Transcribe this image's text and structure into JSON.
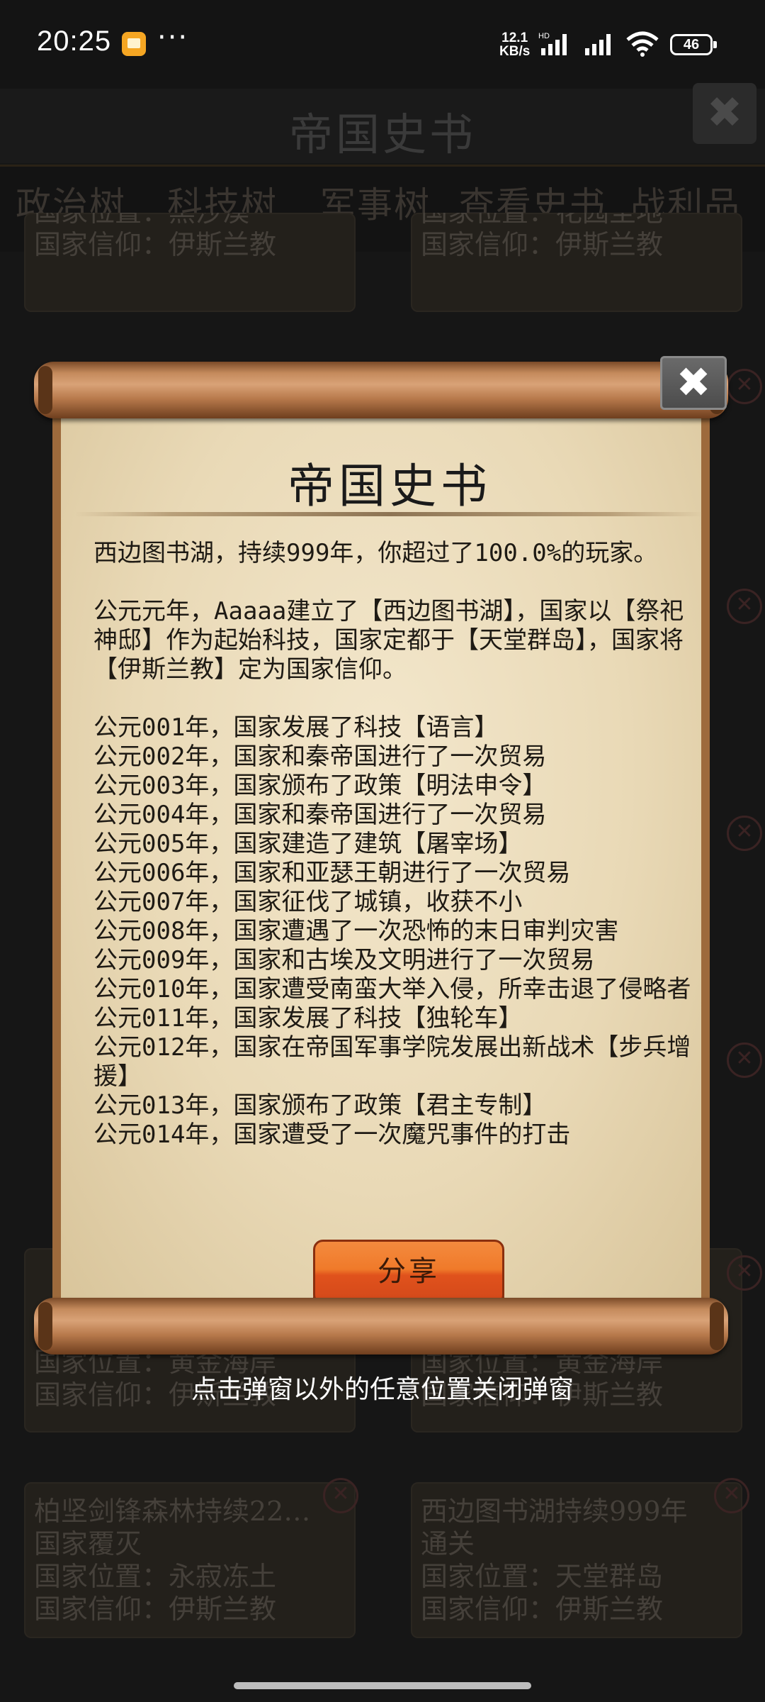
{
  "status_bar": {
    "time": "20:25",
    "speed": "12.1",
    "speed_unit": "KB/s",
    "network": "HD",
    "battery": "46"
  },
  "app": {
    "title": "帝国史书",
    "tabs": [
      "政治树",
      "科技树",
      "军事树",
      "查看史书",
      "战利品"
    ],
    "cards": [
      {
        "lines": [
          "国家位置：黑沙漠",
          "国家信仰：伊斯兰教"
        ]
      },
      {
        "lines": [
          "国家位置：花园圣地",
          "国家信仰：伊斯兰教"
        ]
      },
      {
        "lines": [
          "国家位置：黄金海岸",
          "国家信仰：伊斯兰教"
        ]
      },
      {
        "lines": [
          "国家位置：黄金海岸",
          "国家信仰：伊斯兰教"
        ]
      },
      {
        "lines": [
          "柏坚剑锋森林持续22…",
          "国家覆灭",
          "国家位置：永寂冻土",
          "国家信仰：伊斯兰教"
        ]
      },
      {
        "lines": [
          "西边图书湖持续999年",
          "通关",
          "国家位置：天堂群岛",
          "国家信仰：伊斯兰教"
        ]
      }
    ]
  },
  "modal": {
    "title": "帝国史书",
    "close_label": "✖",
    "summary": "西边图书湖，持续999年，你超过了100.0%的玩家。",
    "founding": "公元元年，Aaaaa建立了【西边图书湖】，国家以【祭祀神邸】作为起始科技，国家定都于【天堂群岛】，国家将【伊斯兰教】定为国家信仰。",
    "events": [
      "公元001年，国家发展了科技【语言】",
      "公元002年，国家和秦帝国进行了一次贸易",
      "公元003年，国家颁布了政策【明法申令】",
      "公元004年，国家和秦帝国进行了一次贸易",
      "公元005年，国家建造了建筑【屠宰场】",
      "公元006年，国家和亚瑟王朝进行了一次贸易",
      "公元007年，国家征伐了城镇，收获不小",
      "公元008年，国家遭遇了一次恐怖的末日审判灾害",
      "公元009年，国家和古埃及文明进行了一次贸易",
      "公元010年，国家遭受南蛮大举入侵，所幸击退了侵略者",
      "公元011年，国家发展了科技【独轮车】",
      "公元012年，国家在帝国军事学院发展出新战术【步兵增援】",
      "公元013年，国家颁布了政策【君主专制】",
      "公元014年，国家遭受了一次魔咒事件的打击"
    ],
    "share_label": "分享"
  },
  "hint": "点击弹窗以外的任意位置关闭弹窗"
}
